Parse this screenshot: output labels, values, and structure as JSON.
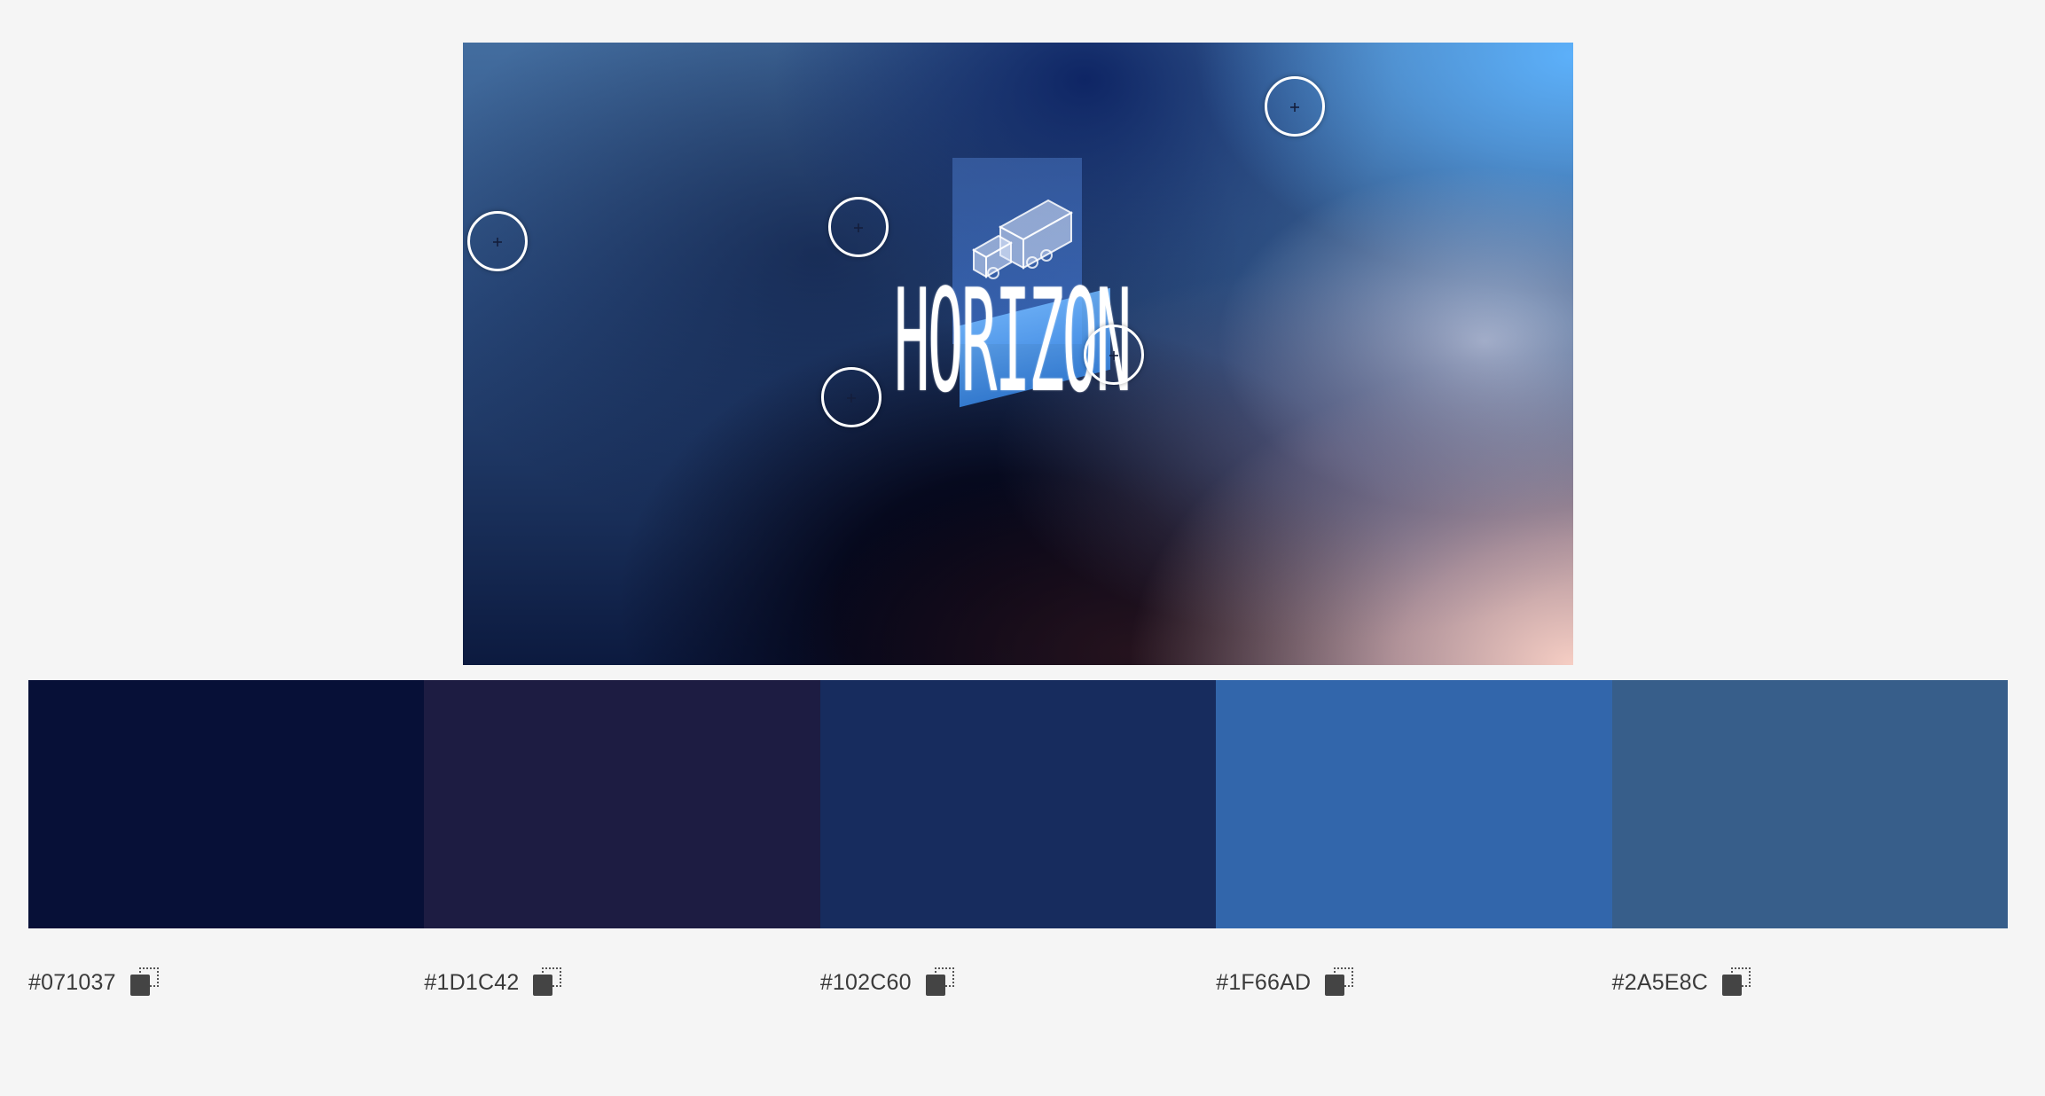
{
  "source_image": {
    "logo_text": "HORIZON"
  },
  "palette": {
    "swatches": [
      {
        "hex": "#071037",
        "color": "#071037"
      },
      {
        "hex": "#1D1C42",
        "color": "#1D1C42"
      },
      {
        "hex": "#102C60",
        "color": "#172C5E"
      },
      {
        "hex": "#1F66AD",
        "color": "#3266AB"
      },
      {
        "hex": "#2A5E8C",
        "color": "#375E8A"
      }
    ]
  },
  "icons": {
    "copy": "copy-icon",
    "marker": "crosshair-icon",
    "truck": "truck-icon"
  }
}
